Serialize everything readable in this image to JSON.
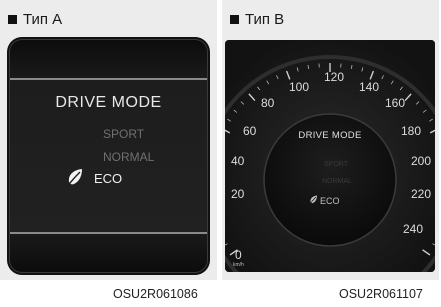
{
  "panel_a": {
    "label": "Тип A",
    "screen_title": "DRIVE MODE",
    "modes": [
      "SPORT",
      "NORMAL",
      "ECO"
    ],
    "caption": "OSU2R061086"
  },
  "panel_b": {
    "label": "Тип B",
    "screen_title": "DRIVE MODE",
    "modes": [
      "SPORT",
      "NORMAL",
      "ECO"
    ],
    "speed_labels": [
      "100",
      "120",
      "140",
      "80",
      "160",
      "60",
      "180",
      "40",
      "200",
      "20",
      "220",
      "240"
    ],
    "zero_label": "0",
    "unit_label": "km/h",
    "caption": "OSU2R061107"
  },
  "colors": {
    "active_mode": "#f2f2f2",
    "inactive_mode": "#707070",
    "background": "#ececec"
  },
  "icons": {
    "eco_leaf": "leaf-icon"
  }
}
